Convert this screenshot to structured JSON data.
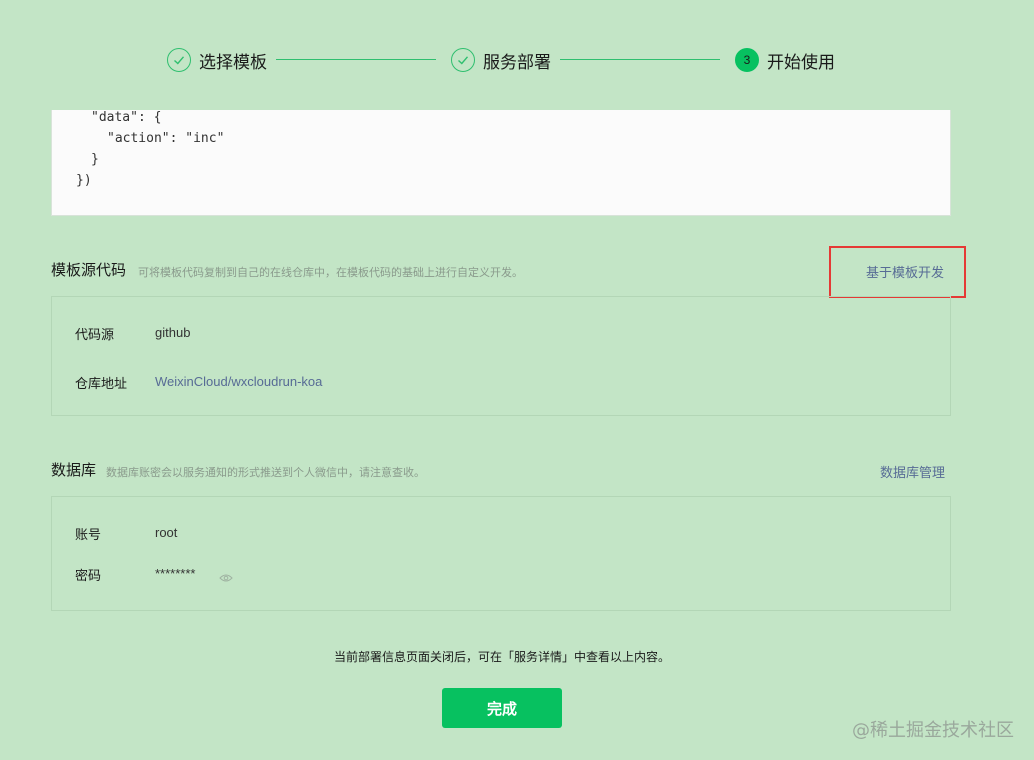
{
  "stepper": {
    "steps": [
      {
        "label": "选择模板",
        "state": "done"
      },
      {
        "label": "服务部署",
        "state": "done"
      },
      {
        "label": "开始使用",
        "state": "active",
        "number": "3"
      }
    ]
  },
  "code": {
    "lines": [
      "\"data\": {",
      "\"action\": \"inc\"",
      "}",
      "})"
    ]
  },
  "template_source": {
    "title": "模板源代码",
    "description": "可将模板代码复制到自己的在线仓库中，在模板代码的基础上进行自定义开发。",
    "action_label": "基于模板开发",
    "rows": {
      "source_label": "代码源",
      "source_value": "github",
      "repo_label": "仓库地址",
      "repo_value": "WeixinCloud/wxcloudrun-koa"
    }
  },
  "database": {
    "title": "数据库",
    "description": "数据库账密会以服务通知的形式推送到个人微信中，请注意查收。",
    "action_label": "数据库管理",
    "rows": {
      "account_label": "账号",
      "account_value": "root",
      "password_label": "密码",
      "password_value": "********"
    }
  },
  "footer": {
    "notice": "当前部署信息页面关闭后，可在「服务详情」中查看以上内容。",
    "done_label": "完成"
  },
  "watermark": "@稀土掘金技术社区",
  "colors": {
    "background": "#c3e5c6",
    "accent": "#07c160",
    "link": "#576b95",
    "highlight": "#e53935"
  }
}
